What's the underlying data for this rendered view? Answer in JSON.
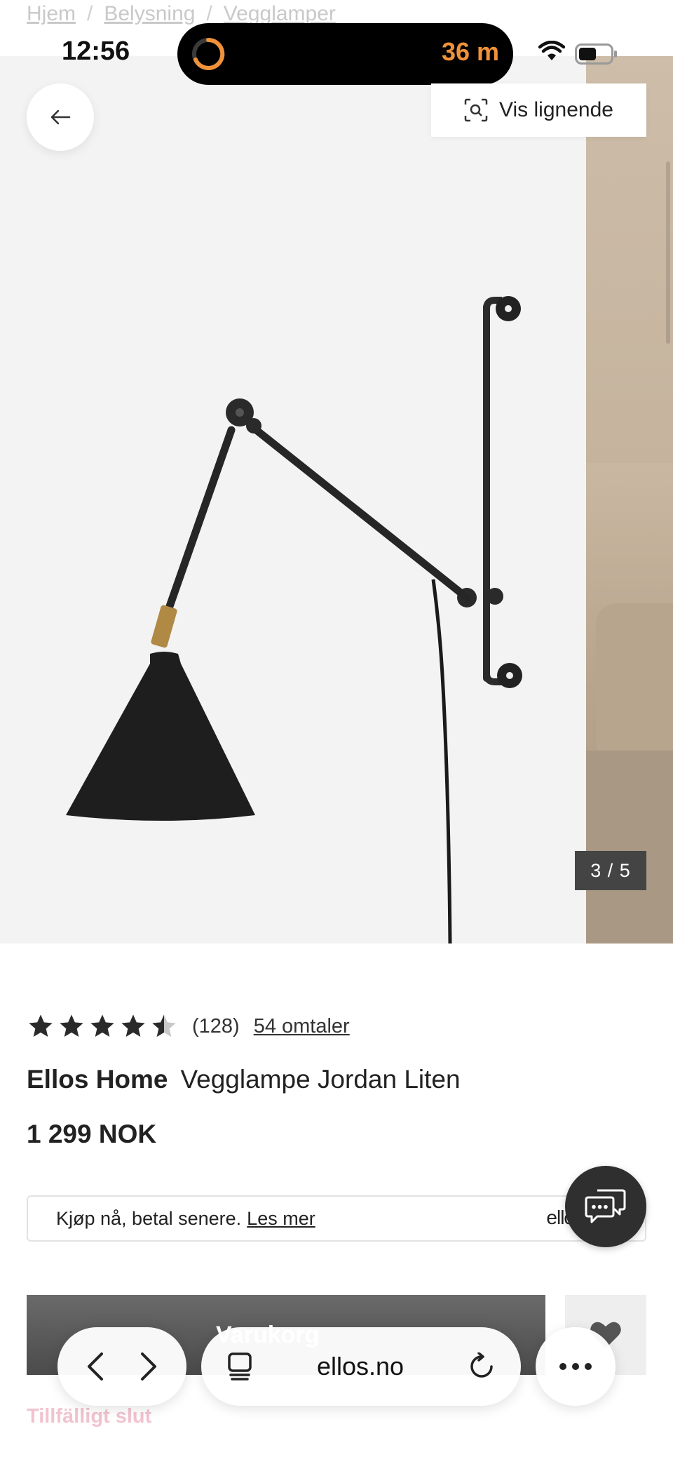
{
  "breadcrumb": {
    "items": [
      "Hjem",
      "Belysning",
      "Vegglamper"
    ],
    "separator": "/"
  },
  "status_bar": {
    "time": "12:56",
    "timer": "36 m"
  },
  "gallery": {
    "visual_search_label": "Vis lignende",
    "counter": "3 / 5"
  },
  "product": {
    "rating_value": 4.5,
    "rating_count": "(128)",
    "reviews_link": "54 omtaler",
    "brand": "Ellos Home",
    "name": "Vegglampe Jordan Liten",
    "price": "1 299 NOK"
  },
  "finance": {
    "text": "Kjøp nå, betal senere.",
    "link": "Les mer",
    "logo": "ellos"
  },
  "actions": {
    "buy_label": "Varukorg",
    "stock_status": "Tillfälligt slut"
  },
  "browser": {
    "address": "ellos.no"
  },
  "colors": {
    "timer_accent": "#f0923a",
    "stock_status": "#f2c3cf",
    "buy_button": "#4b4b4b",
    "chat_button": "#2f2f2f"
  },
  "icons": [
    "arrow-left-icon",
    "visual-search-icon",
    "star-icon",
    "chat-icon",
    "heart-icon",
    "chevron-left-icon",
    "chevron-right-icon",
    "tabs-icon",
    "reload-icon",
    "more-icon",
    "wifi-icon",
    "battery-icon"
  ]
}
